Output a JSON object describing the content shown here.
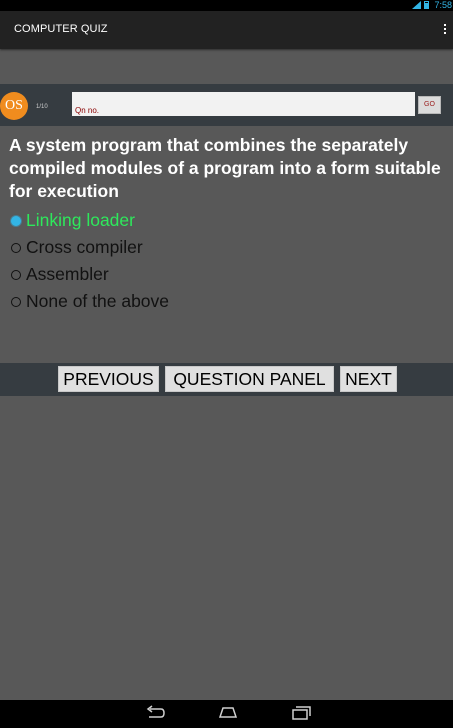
{
  "status_bar": {
    "time": "7:58",
    "signal_icon": "signal-icon",
    "battery_icon": "battery-icon"
  },
  "action_bar": {
    "title": "COMPUTER QUIZ",
    "overflow_icon": "overflow-menu-icon"
  },
  "question_header": {
    "subject_logo": "OS",
    "question_count": "1/10",
    "qn_input": {
      "value": "",
      "placeholder": "Qn no."
    },
    "go_label": "GO"
  },
  "question": {
    "text": "A system program that combines the separately compiled modules of a program into a form suitable for execution"
  },
  "options": [
    {
      "label": "Linking loader",
      "selected": true
    },
    {
      "label": "Cross compiler",
      "selected": false
    },
    {
      "label": "Assembler",
      "selected": false
    },
    {
      "label": "None of the above",
      "selected": false
    }
  ],
  "navigation": {
    "previous_label": "PREVIOUS",
    "panel_label": "QUESTION PANEL",
    "next_label": "NEXT"
  },
  "colors": {
    "selected_option": "#2ee85c",
    "radio_checked": "#33b5e5",
    "subject_logo_bg": "#f08c1e",
    "background": "#585858",
    "panel": "#363c41"
  },
  "system_nav": {
    "back_icon": "back-icon",
    "home_icon": "home-icon",
    "recents_icon": "recents-icon"
  }
}
